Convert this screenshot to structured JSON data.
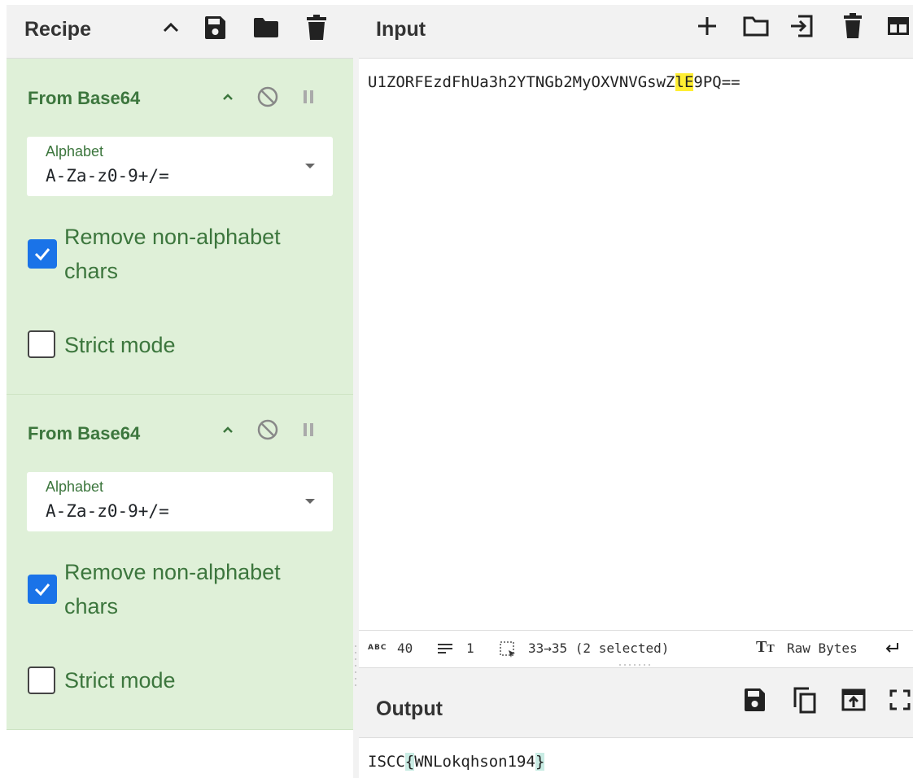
{
  "recipe": {
    "title": "Recipe",
    "operations": [
      {
        "name": "From Base64",
        "alphabet_label": "Alphabet",
        "alphabet_value": "A-Za-z0-9+/=",
        "remove_non_alphabet": {
          "label_line1": "Remove non-alphabet",
          "label_line2": "chars",
          "checked": true
        },
        "strict_mode": {
          "label": "Strict mode",
          "checked": false
        }
      },
      {
        "name": "From Base64",
        "alphabet_label": "Alphabet",
        "alphabet_value": "A-Za-z0-9+/=",
        "remove_non_alphabet": {
          "label_line1": "Remove non-alphabet",
          "label_line2": "chars",
          "checked": true
        },
        "strict_mode": {
          "label": "Strict mode",
          "checked": false
        }
      }
    ],
    "header_icons": [
      "chevron-up-icon",
      "save-icon",
      "folder-icon",
      "trash-icon"
    ]
  },
  "input": {
    "title": "Input",
    "text_before": "U1ZORFEzdFhUa3h2YTNGb2MyOXVNVGswZ",
    "text_selected": "lE",
    "text_after": "9PQ==",
    "header_icons": [
      "plus-icon",
      "folder-icon",
      "input-arrow-icon",
      "trash-icon",
      "layout-icon"
    ]
  },
  "status": {
    "length_value": "40",
    "lines_value": "1",
    "selection": "33→35 (2 selected)",
    "encoding": "Raw Bytes"
  },
  "output": {
    "title": "Output",
    "text_prefix": "ISCC",
    "brace_open": "{",
    "text_middle": "WNLokqhson194",
    "brace_close": "}",
    "header_icons": [
      "save-icon",
      "copy-icon",
      "replace-input-icon",
      "maximise-icon"
    ]
  },
  "colors": {
    "op_background": "#dff0d8",
    "op_text": "#3c763d",
    "checkbox_checked": "#1a73e8",
    "selection_highlight": "#ffee33",
    "bracket_highlight": "#c9ece4"
  }
}
